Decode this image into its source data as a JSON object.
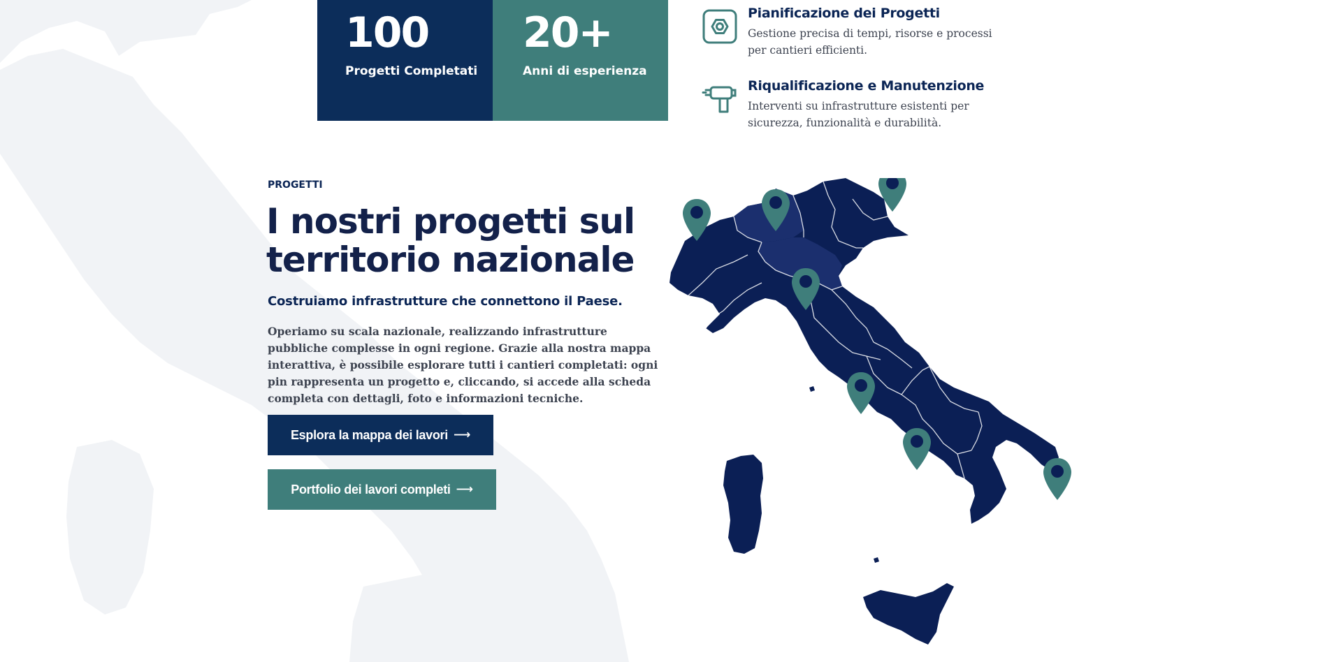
{
  "stats": [
    {
      "number": "100",
      "label": "Progetti Completati"
    },
    {
      "number": "20+",
      "label": "Anni di esperienza"
    }
  ],
  "services": [
    {
      "icon": "bolt-nut-icon",
      "title": "Pianificazione dei Progetti",
      "description": "Gestione precisa di tempi, risorse e processi per cantieri efficienti."
    },
    {
      "icon": "drill-icon",
      "title": "Riqualificazione e Manutenzione",
      "description": "Interventi su infrastrutture esistenti per sicurezza, funzionalità e durabilità."
    }
  ],
  "projects": {
    "eyebrow": "PROGETTI",
    "heading": "I nostri progetti sul territorio nazionale",
    "subheading": "Costruiamo infrastrutture che connettono il Paese.",
    "body": "Operiamo su scala nazionale, realizzando infrastrutture pubbliche complesse in ogni regione. Grazie alla nostra mappa interattiva, è possibile esplorare tutti i cantieri completati: ogni pin rappresenta un progetto e, cliccando, si accede alla scheda completa con dettagli, foto e informazioni tecniche.",
    "primary_button": "Esplora la mappa dei lavori",
    "secondary_button": "Portfolio dei lavori completi",
    "arrow": "⟶"
  },
  "map": {
    "pins": [
      {
        "name": "map-pin-piemonte"
      },
      {
        "name": "map-pin-lombardia"
      },
      {
        "name": "map-pin-friuli"
      },
      {
        "name": "map-pin-emilia"
      },
      {
        "name": "map-pin-lazio"
      },
      {
        "name": "map-pin-campania"
      },
      {
        "name": "map-pin-puglia"
      }
    ]
  },
  "colors": {
    "navy": "#0c2d5a",
    "teal": "#3f7e7b",
    "map_dark": "#0b1f55",
    "map_highlight": "#1b2f6e",
    "background_map": "#f1f3f6"
  }
}
